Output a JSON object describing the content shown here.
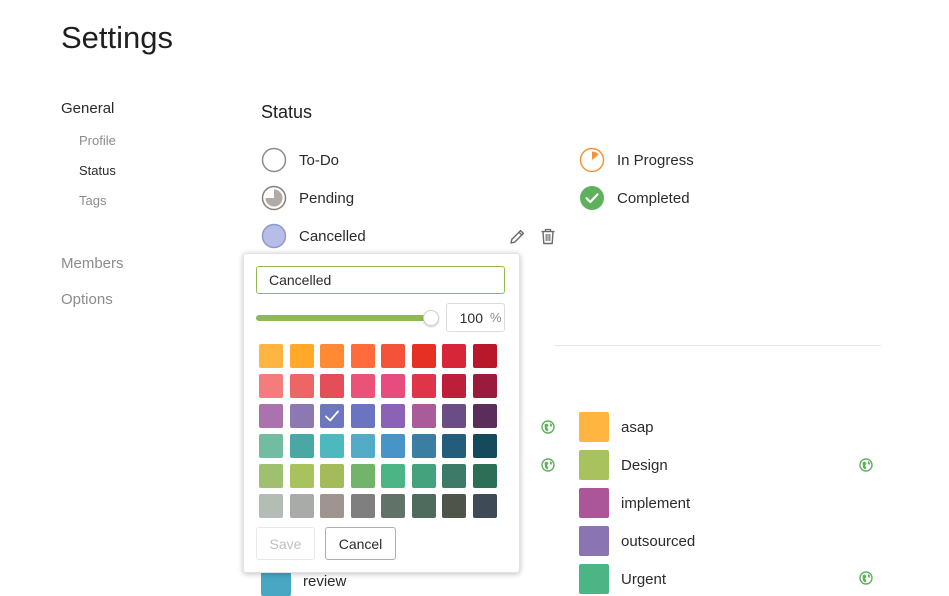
{
  "page": {
    "title": "Settings"
  },
  "nav": {
    "general": "General",
    "general_items": [
      "Profile",
      "Status",
      "Tags"
    ],
    "members": "Members",
    "options": "Options"
  },
  "status_section": {
    "title": "Status",
    "statuses": [
      {
        "label": "To-Do",
        "icon": "empty-circle-icon"
      },
      {
        "label": "In Progress",
        "icon": "progress-circle-icon"
      },
      {
        "label": "Pending",
        "icon": "pie-circle-icon"
      },
      {
        "label": "Completed",
        "icon": "check-circle-icon"
      },
      {
        "label": "Cancelled",
        "icon": "filled-circle-icon",
        "color": "#b7bde6"
      }
    ]
  },
  "tags": [
    {
      "label": "asap",
      "color": "#ffb540",
      "shared": false
    },
    {
      "label": "Design",
      "color": "#a8c35d",
      "shared": true
    },
    {
      "label": "implement",
      "color": "#ab5699",
      "shared": false
    },
    {
      "label": "outsourced",
      "color": "#8a74b2",
      "shared": false
    },
    {
      "label": "Urgent",
      "color": "#4cb585",
      "shared": true
    },
    {
      "label": "review",
      "color": "#48a8c4",
      "shared": false
    }
  ],
  "editor": {
    "name_value": "Cancelled",
    "opacity": "100",
    "opacity_unit": "%",
    "opacity_fraction": 1.0,
    "selected_color": "#6c77be",
    "save_label": "Save",
    "cancel_label": "Cancel",
    "palette": [
      "#ffb540",
      "#ffa82a",
      "#ff8a33",
      "#ff6b3a",
      "#f5523a",
      "#e63023",
      "#d72638",
      "#b8182a",
      "#f47c7c",
      "#ee6565",
      "#e44e58",
      "#ea5277",
      "#e64d7e",
      "#e0344a",
      "#bd1f3b",
      "#9c1a3c",
      "#ab73ad",
      "#8c79b1",
      "#6c77be",
      "#6a74c0",
      "#8b62b5",
      "#a95b9a",
      "#6b4d85",
      "#5a2d5a",
      "#72bca2",
      "#4aa8a4",
      "#4cb9bf",
      "#53acc7",
      "#4694c8",
      "#3a7ea1",
      "#235d7b",
      "#154a5c",
      "#9fc06f",
      "#a8c35d",
      "#a4bb5a",
      "#72b56a",
      "#4cb585",
      "#44a27c",
      "#3d7b68",
      "#2b6f57",
      "#b3bcb5",
      "#a8aba8",
      "#9f9490",
      "#7f7f7f",
      "#617268",
      "#4e6b5e",
      "#4e5449",
      "#3e4a55"
    ]
  }
}
